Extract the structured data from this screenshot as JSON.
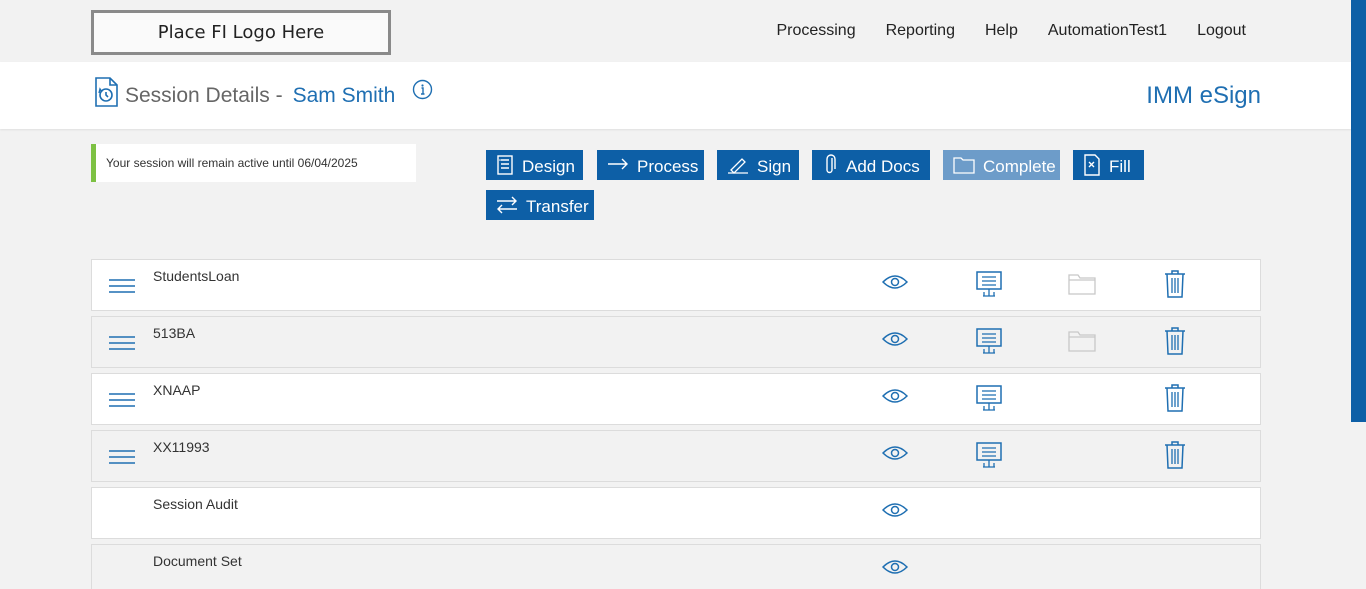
{
  "topbar": {
    "logo_text": "Place FI Logo Here",
    "nav": [
      "Processing",
      "Reporting",
      "Help",
      "AutomationTest1",
      "Logout"
    ]
  },
  "header": {
    "title": "Session Details -",
    "customer_name": "Sam Smith",
    "brand": "IMM eSign"
  },
  "notice": "Your session will remain active until 06/04/2025",
  "actions": {
    "design": "Design",
    "process": "Process",
    "sign": "Sign",
    "add_docs": "Add Docs",
    "complete": "Complete",
    "fill": "Fill",
    "transfer": "Transfer"
  },
  "documents": [
    {
      "name": "StudentsLoan",
      "icons": [
        "eye-icon",
        "presentation-icon",
        "folder-icon",
        "trash-icon"
      ]
    },
    {
      "name": "513BA",
      "icons": [
        "eye-icon",
        "presentation-icon",
        "folder-icon",
        "trash-icon"
      ]
    },
    {
      "name": "XNAAP",
      "icons": [
        "eye-icon",
        "presentation-icon",
        "trash-icon"
      ]
    },
    {
      "name": "XX11993",
      "icons": [
        "eye-icon",
        "presentation-icon",
        "trash-icon"
      ]
    },
    {
      "name": "Session Audit",
      "icons": [
        "eye-icon"
      ]
    },
    {
      "name": "Document Set",
      "icons": [
        "eye-icon"
      ]
    }
  ],
  "colors": {
    "primary": "#0d5fa6",
    "accent_text": "#1f6fb2",
    "disabled_button": "#6d9cc9",
    "notice_bar": "#7dc143"
  }
}
